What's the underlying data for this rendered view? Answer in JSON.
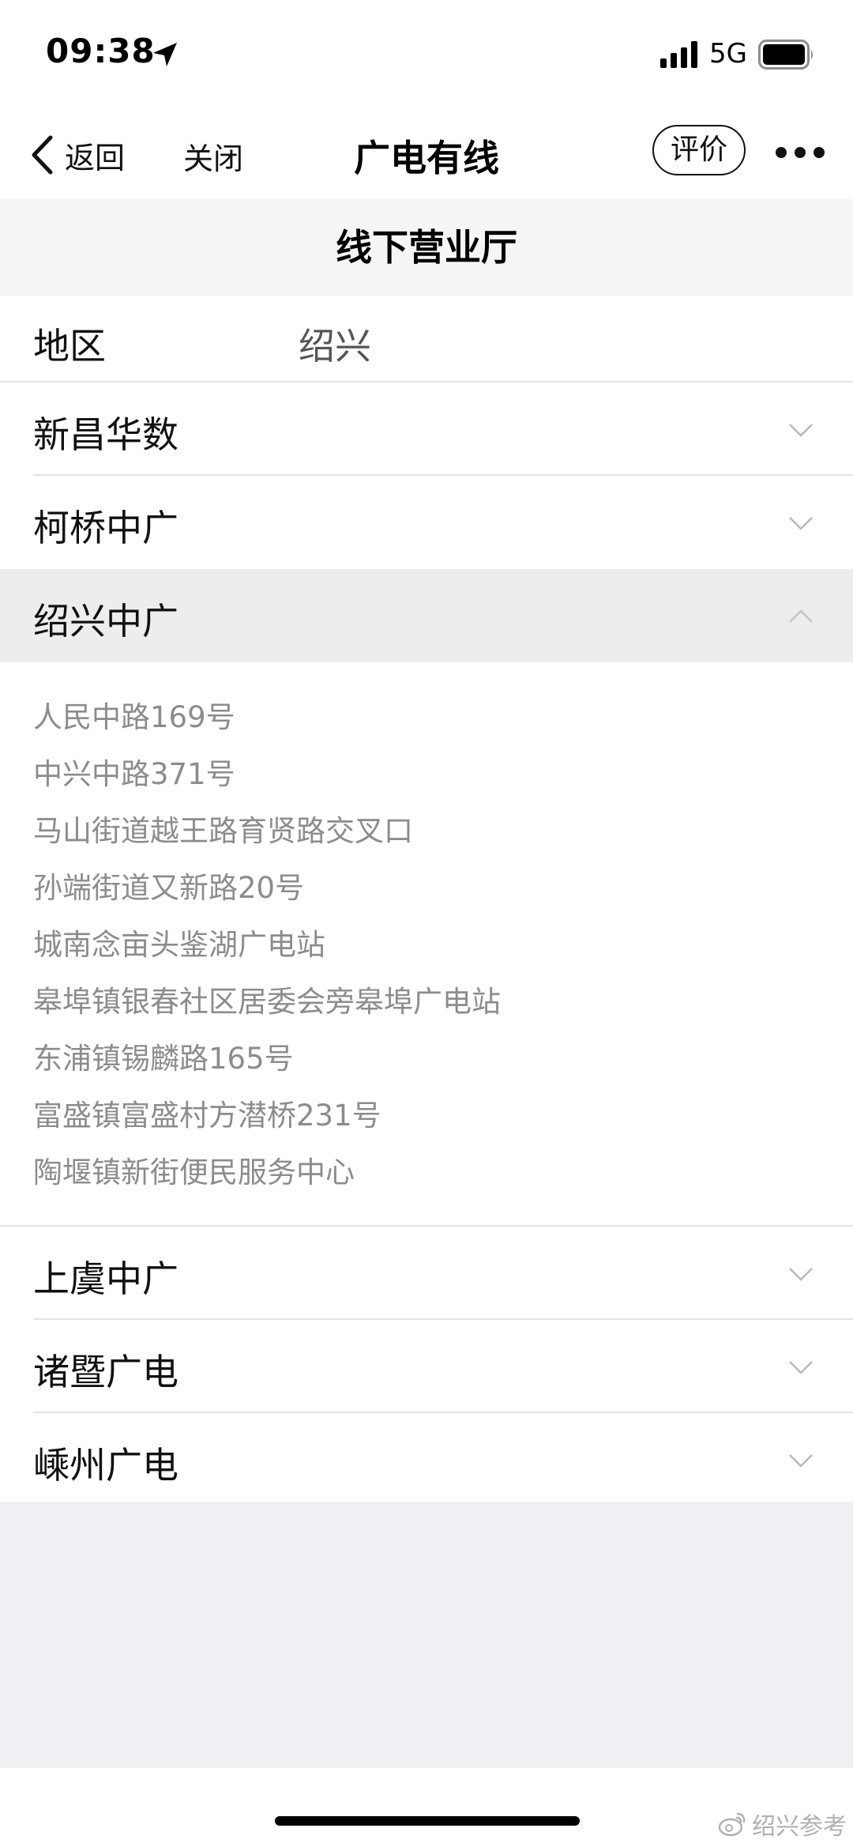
{
  "status_bar": {
    "time": "09:38",
    "network": "5G",
    "icons": [
      "location-arrow-icon",
      "signal-icon",
      "battery-icon"
    ]
  },
  "nav": {
    "back_label": "返回",
    "close_label": "关闭",
    "title": "广电有线",
    "rate_label": "评价",
    "more_icon": "more-dots-icon"
  },
  "page": {
    "header_title": "线下营业厅"
  },
  "region": {
    "label": "地区",
    "value": "绍兴"
  },
  "accordion": {
    "items": [
      {
        "title": "新昌华数",
        "expanded": false
      },
      {
        "title": "柯桥中广",
        "expanded": false
      },
      {
        "title": "绍兴中广",
        "expanded": true,
        "addresses": [
          "人民中路169号",
          "中兴中路371号",
          "马山街道越王路育贤路交叉口",
          "孙端街道又新路20号",
          "城南念亩头鉴湖广电站",
          "皋埠镇银春社区居委会旁皋埠广电站",
          "东浦镇锡麟路165号",
          "富盛镇富盛村方潜桥231号",
          "陶堰镇新街便民服务中心"
        ]
      },
      {
        "title": "上虞中广",
        "expanded": false
      },
      {
        "title": "诸暨广电",
        "expanded": false
      },
      {
        "title": "嵊州广电",
        "expanded": false
      }
    ]
  },
  "watermark": {
    "text": "绍兴参考",
    "icon": "weibo-icon"
  },
  "colors": {
    "expanded_header_bg": "#ededed",
    "address_text": "#8c8c8c",
    "bottom_area_bg": "#f0eff4"
  }
}
